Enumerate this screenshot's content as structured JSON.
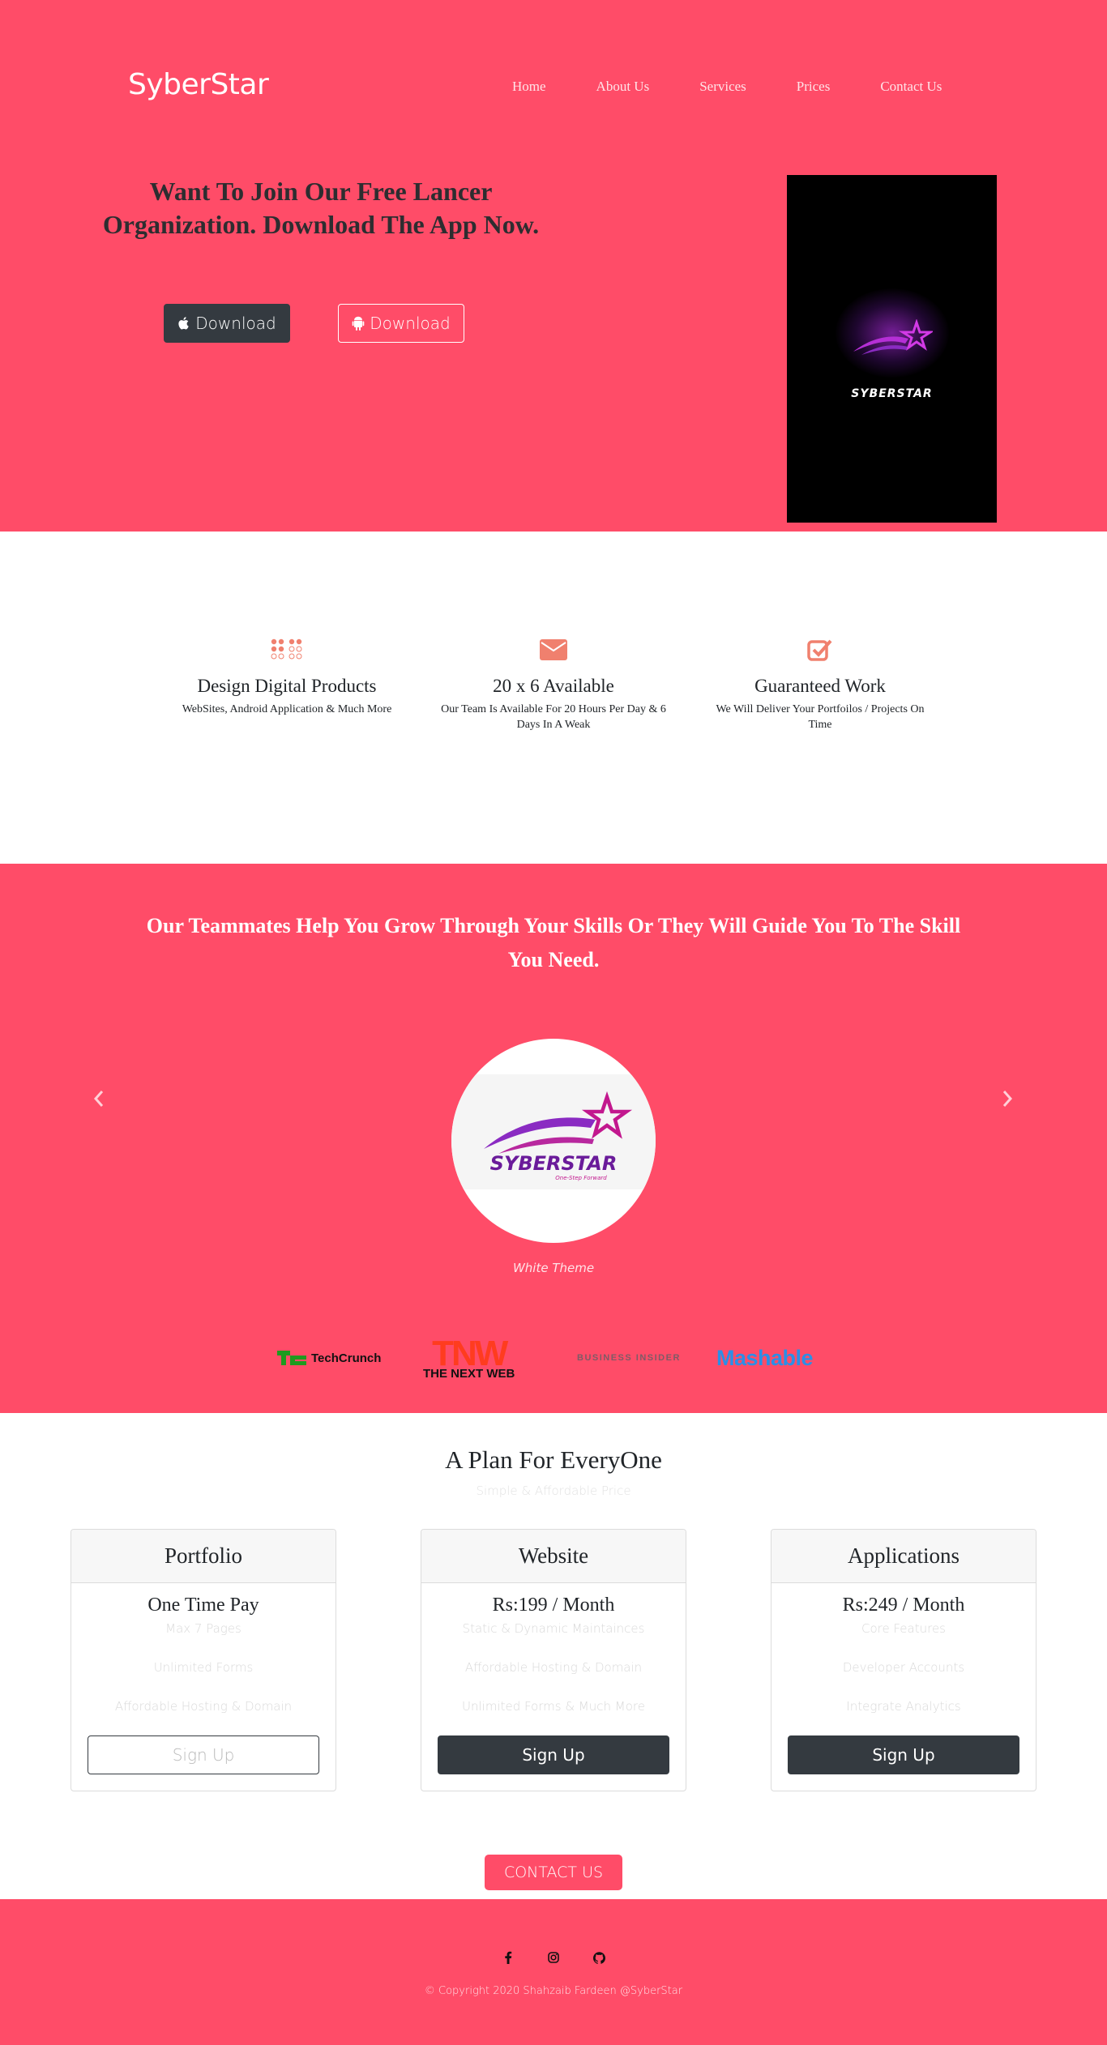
{
  "brand": "SyberStar",
  "nav": {
    "items": [
      "Home",
      "About Us",
      "Services",
      "Prices",
      "Contact Us"
    ]
  },
  "hero": {
    "heading": "Want To Join Our Free Lancer Organization. Download The App Now.",
    "ios_button": "Download",
    "android_button": "Download",
    "phone_text": "SYBERSTAR"
  },
  "features": [
    {
      "icon": "apps-grid-icon",
      "title": "Design Digital Products",
      "text": "WebSites, Android Application & Much More"
    },
    {
      "icon": "envelope-icon",
      "title": "20 x 6 Available",
      "text": "Our Team Is Available For 20 Hours Per Day & 6 Days In A Weak"
    },
    {
      "icon": "check-square-icon",
      "title": "Guaranteed Work",
      "text": "We Will Deliver Your Portfoilos / Projects On Time"
    }
  ],
  "team": {
    "heading": "Our Teammates Help You Grow Through Your Skills Or They Will Guide You To The Skill You Need.",
    "carousel_caption": "White Theme",
    "logo_text": "SYBERSTAR",
    "logo_tagline": "One-Step Forward",
    "press": {
      "techcrunch": "TechCrunch",
      "tnw_mark": "TNW",
      "tnw_name": "THE NEXT WEB",
      "business_insider": "BUSINESS INSIDER",
      "mashable": "Mashable"
    }
  },
  "pricing": {
    "title": "A Plan For EveryOne",
    "subtitle": "Simple & Affordable Price",
    "plans": [
      {
        "name": "Portfolio",
        "price": "One Time Pay",
        "features": [
          "Max 7 Pages",
          "Unlimited Forms",
          "Affordable Hosting & Domain"
        ],
        "button": "Sign Up"
      },
      {
        "name": "Website",
        "price": "Rs:199 / Month",
        "features": [
          "Static & Dynamic Maintainces",
          "Affordable Hosting & Domain",
          "Unlimited Forms & Much More"
        ],
        "button": "Sign Up"
      },
      {
        "name": "Applications",
        "price": "Rs:249 / Month",
        "features": [
          "Core Features",
          "Developer Accounts",
          "Integrate Analytics"
        ],
        "button": "Sign Up"
      }
    ],
    "contact_button": "CONTACT US"
  },
  "footer": {
    "social_icons": [
      "facebook-icon",
      "instagram-icon",
      "github-icon"
    ],
    "copyright": "© Copyright 2020 Shahzaib Fardeen @SyberStar"
  },
  "colors": {
    "brand_pink": "#ff4c68",
    "dark": "#343a40",
    "feature_icon": "#f0806e"
  }
}
